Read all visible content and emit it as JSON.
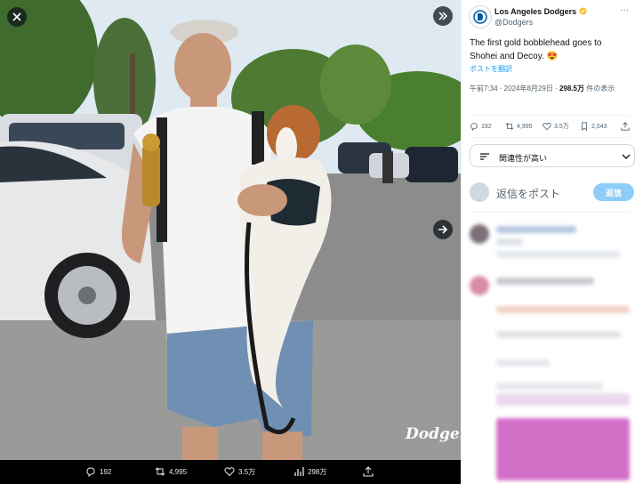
{
  "media": {
    "watermark": "Dodgers",
    "actions": {
      "replies": "192",
      "reposts": "4,995",
      "likes": "3.5万",
      "views": "298万"
    }
  },
  "tweet": {
    "display_name": "Los Angeles Dodgers",
    "handle": "@Dodgers",
    "text": "The first gold bobblehead goes to Shohei and Decoy. 😍",
    "translate_label": "ポストを翻訳",
    "timestamp": "午前7:34 · 2024年8月29日 · ",
    "views_count": "298.5万",
    "views_label": " 件の表示",
    "stats": {
      "replies": "192",
      "reposts": "4,995",
      "likes": "3.5万",
      "bookmarks": "2,043"
    }
  },
  "sort": {
    "label": "関連性が高い"
  },
  "reply": {
    "placeholder": "返信をポスト",
    "button": "返信"
  },
  "colors": {
    "accent": "#1d9bf0",
    "verified": "#f4c430",
    "media_bg": "#000000"
  },
  "icons": [
    "close-icon",
    "collapse-icon",
    "next-arrow-icon",
    "reply-icon",
    "repost-icon",
    "like-icon",
    "views-icon",
    "share-icon",
    "bookmark-icon",
    "sort-icon",
    "chevron-down-icon",
    "verified-badge-icon",
    "more-icon"
  ]
}
